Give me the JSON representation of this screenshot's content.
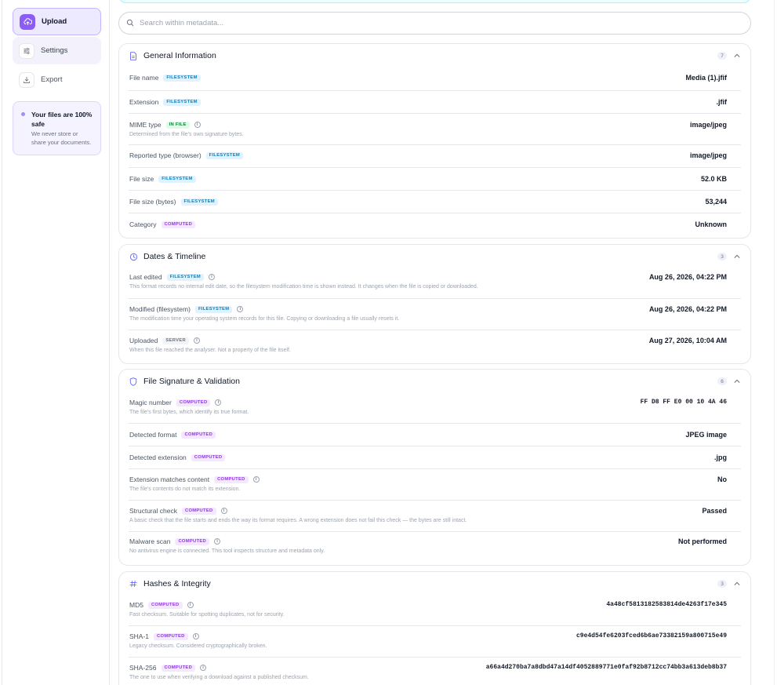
{
  "sidebar": {
    "items": [
      {
        "label": "Upload",
        "icon": "upload-cloud-icon"
      },
      {
        "label": "Settings",
        "icon": "sliders-icon"
      },
      {
        "label": "Export",
        "icon": "download-icon"
      }
    ],
    "safe_title": "Your files are 100% safe",
    "safe_text": "We never store or share your documents."
  },
  "search": {
    "placeholder": "Search within metadata..."
  },
  "sections": {
    "general": {
      "title": "General Information",
      "count": "7",
      "rows": [
        {
          "label": "File name",
          "badge": "FILESYSTEM",
          "value": "Media (1).jfif"
        },
        {
          "label": "Extension",
          "badge": "FILESYSTEM",
          "value": ".jfif"
        },
        {
          "label": "MIME type",
          "badge": "IN FILE",
          "sub": "Determined from the file's own signature bytes.",
          "value": "image/jpeg"
        },
        {
          "label": "Reported type (browser)",
          "badge": "FILESYSTEM",
          "value": "image/jpeg"
        },
        {
          "label": "File size",
          "badge": "FILESYSTEM",
          "value": "52.0 KB"
        },
        {
          "label": "File size (bytes)",
          "badge": "FILESYSTEM",
          "value": "53,244"
        },
        {
          "label": "Category",
          "badge": "COMPUTED",
          "value": "Unknown"
        }
      ]
    },
    "dates": {
      "title": "Dates & Timeline",
      "count": "3",
      "rows": [
        {
          "label": "Last edited",
          "badge": "FILESYSTEM",
          "sub": "This format records no internal edit date, so the filesystem modification time is shown instead. It changes when the file is copied or downloaded.",
          "value": "Aug 26, 2026, 04:22 PM"
        },
        {
          "label": "Modified (filesystem)",
          "badge": "FILESYSTEM",
          "sub": "The modification time your operating system records for this file. Copying or downloading a file usually resets it.",
          "value": "Aug 26, 2026, 04:22 PM"
        },
        {
          "label": "Uploaded",
          "badge": "SERVER",
          "sub": "When this file reached the analyser. Not a property of the file itself.",
          "value": "Aug 27, 2026, 10:04 AM"
        }
      ]
    },
    "signature": {
      "title": "File Signature & Validation",
      "count": "6",
      "rows": [
        {
          "label": "Magic number",
          "badge": "COMPUTED",
          "sub": "The file's first bytes, which identify its true format.",
          "value": "FF D8 FF E0 00 10 4A 46"
        },
        {
          "label": "Detected format",
          "badge": "COMPUTED",
          "value": "JPEG image"
        },
        {
          "label": "Detected extension",
          "badge": "COMPUTED",
          "value": ".jpg"
        },
        {
          "label": "Extension matches content",
          "badge": "COMPUTED",
          "sub": "The file's contents do not match its extension.",
          "value": "No"
        },
        {
          "label": "Structural check",
          "badge": "COMPUTED",
          "sub": "A basic check that the file starts and ends the way its format requires. A wrong extension does not fail this check — the bytes are still intact.",
          "value": "Passed"
        },
        {
          "label": "Malware scan",
          "badge": "COMPUTED",
          "sub": "No antivirus engine is connected. This tool inspects structure and metadata only.",
          "value": "Not performed"
        }
      ]
    },
    "hashes": {
      "title": "Hashes & Integrity",
      "count": "3",
      "rows": [
        {
          "label": "MD5",
          "badge": "COMPUTED",
          "sub": "Fast checksum. Suitable for spotting duplicates, not for security.",
          "value": "4a48cf5813182583814de4263f17e345"
        },
        {
          "label": "SHA-1",
          "badge": "COMPUTED",
          "sub": "Legacy checksum. Considered cryptographically broken.",
          "value": "c9e4d54fe6203fced6b6ae73382159a800715e49"
        },
        {
          "label": "SHA-256",
          "badge": "COMPUTED",
          "sub": "The one to use when verifying a download against a published checksum.",
          "value": "a66a4d270ba7a8dbd47a14df4052889771e0faf92b8712cc74bb3a613deb8b37"
        }
      ]
    }
  }
}
